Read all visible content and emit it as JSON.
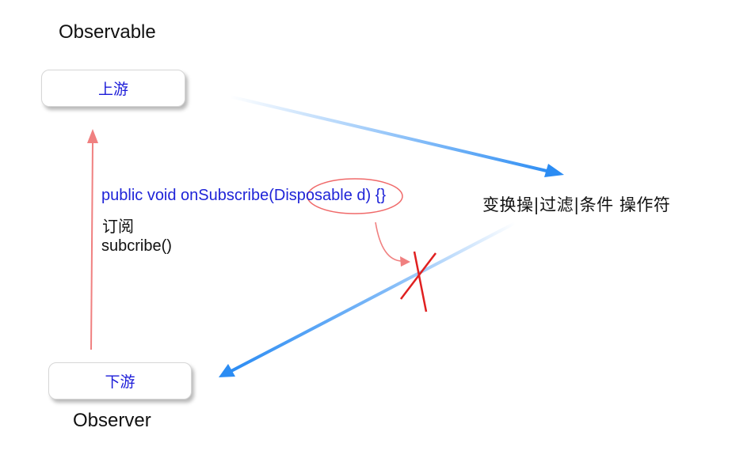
{
  "diagram": {
    "observable_title": "Observable",
    "observer_title": "Observer",
    "upstream_node": {
      "label": "上游"
    },
    "downstream_node": {
      "label": "下游"
    },
    "code": {
      "before_highlight": "public void onSubscribe(",
      "highlight": "Disposable",
      "after_highlight": " d) {}"
    },
    "subscribe_label_cn": "订阅",
    "subscribe_call": "subcribe()",
    "operators_label": "变换操|过滤|条件 操作符",
    "colors": {
      "code_blue": "#1f24d8",
      "node_text_blue": "#1a1ad8",
      "arrow_blue": "#2b8cf3",
      "subscribe_arrow": "#f08080",
      "cross_red": "#e02020",
      "highlight_ellipse": "#f06a6a"
    }
  }
}
